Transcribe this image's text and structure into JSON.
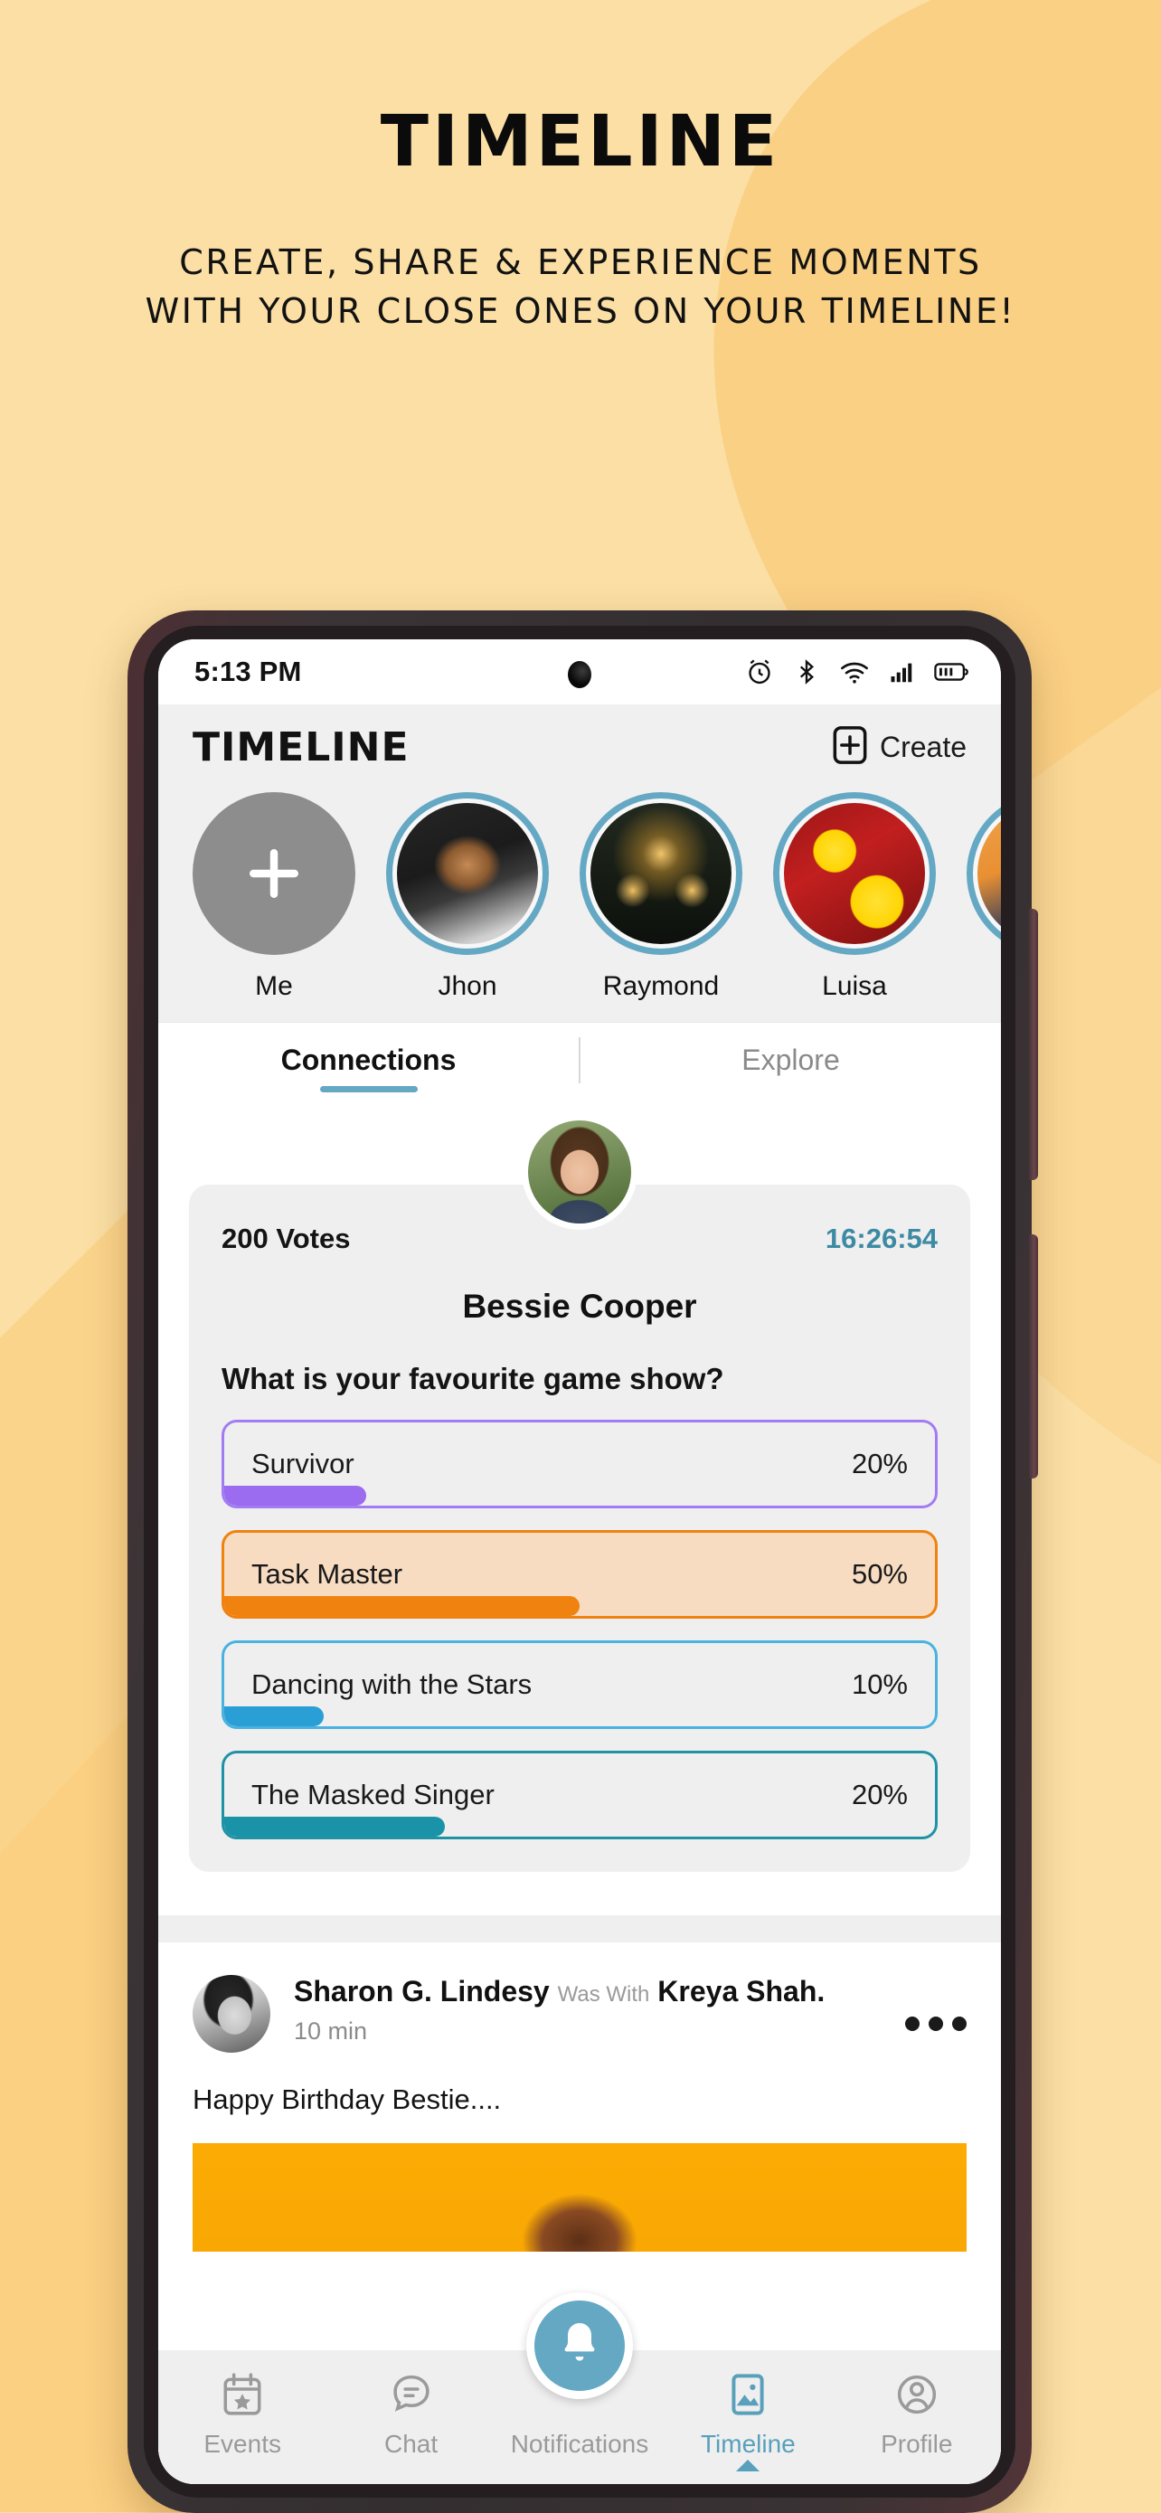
{
  "promo": {
    "title": "TIMELINE",
    "subtitle_line1": "CREATE, SHARE & EXPERIENCE MOMENTS",
    "subtitle_line2": "WITH YOUR CLOSE ONES ON YOUR TIMELINE!"
  },
  "colors": {
    "page_background": "#fbdfa4",
    "background_blob": "#fad085",
    "accent_teal": "#64a8c4",
    "device_frame": "#3a3234",
    "poll_purple": "#9b6bf0",
    "poll_orange": "#f0820f",
    "poll_blue": "#2a9fd6",
    "poll_teal": "#1a93a8",
    "post_photo_orange": "#fcab05"
  },
  "status_bar": {
    "time": "5:13 PM",
    "icons": [
      "alarm-icon",
      "bluetooth-icon",
      "wifi-icon",
      "cellular-signal-icon",
      "battery-icon"
    ]
  },
  "app_header": {
    "title": "TIMELINE",
    "create_label": "Create",
    "create_icon": "add-box-icon"
  },
  "stories": [
    {
      "name": "Me",
      "type": "add",
      "icon": "plus-icon"
    },
    {
      "name": "Jhon",
      "type": "photo",
      "theme": "jhon"
    },
    {
      "name": "Raymond",
      "type": "photo",
      "theme": "raymond"
    },
    {
      "name": "Luisa",
      "type": "photo",
      "theme": "luisa"
    },
    {
      "name": "",
      "type": "photo",
      "theme": "extra"
    }
  ],
  "tabs": [
    {
      "label": "Connections",
      "active": true
    },
    {
      "label": "Explore",
      "active": false
    }
  ],
  "poll_post": {
    "votes": "200 Votes",
    "timer": "16:26:54",
    "author": "Bessie Cooper",
    "question": "What is your favourite game show?",
    "options": [
      {
        "label": "Survivor",
        "percent": "20%",
        "value": 20,
        "color": "#9b6bf0",
        "border": "#a27cf2",
        "highlight": false
      },
      {
        "label": "Task Master",
        "percent": "50%",
        "value": 50,
        "color": "#f0820f",
        "border": "#f0820f",
        "highlight": true
      },
      {
        "label": "Dancing with the Stars",
        "percent": "10%",
        "value": 10,
        "color": "#2a9fd6",
        "border": "#49b2e0",
        "highlight": false
      },
      {
        "label": "The Masked Singer",
        "percent": "20%",
        "value": 20,
        "color": "#1a93a8",
        "border": "#1f93a6",
        "highlight": false
      }
    ]
  },
  "post": {
    "author": "Sharon G. Lindesy",
    "with_text": "Was With",
    "with_person": "Kreya Shah.",
    "time": "10 min",
    "text": "Happy Birthday Bestie....",
    "menu_icon": "more-horizontal-icon"
  },
  "bottom_nav": [
    {
      "label": "Events",
      "icon": "calendar-star-icon",
      "active": false
    },
    {
      "label": "Chat",
      "icon": "chat-bubble-icon",
      "active": false
    },
    {
      "label": "Notifications",
      "icon": "bell-icon",
      "active": false
    },
    {
      "label": "Timeline",
      "icon": "image-photo-icon",
      "active": true
    },
    {
      "label": "Profile",
      "icon": "person-circle-icon",
      "active": false
    }
  ]
}
